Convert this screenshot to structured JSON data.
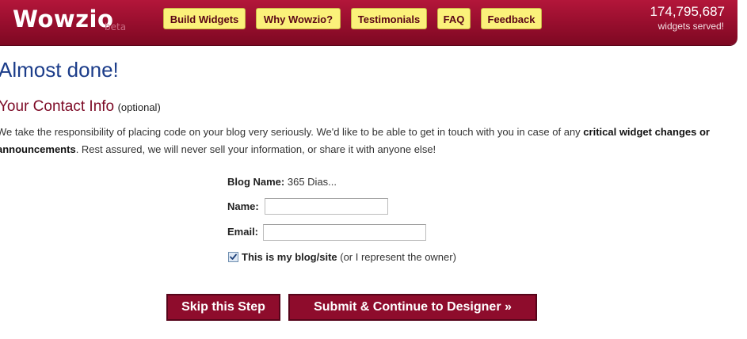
{
  "header": {
    "logo_text": "Wowzio",
    "logo_badge": "beta",
    "nav": [
      {
        "label": "Build Widgets"
      },
      {
        "label": "Why Wowzio?"
      },
      {
        "label": "Testimonials"
      },
      {
        "label": "FAQ"
      },
      {
        "label": "Feedback"
      }
    ],
    "widgets_served_count": "174,795,687",
    "widgets_served_label": "widgets served!",
    "colors": {
      "bar": "#9b0f2f",
      "nav_button": "#fbf17a",
      "nav_text": "#5a0616"
    }
  },
  "main": {
    "title": "Almost done!",
    "section_title": "Your Contact Info",
    "section_note": "(optional)",
    "intro": {
      "text_1": "We take the responsibility of placing code on your blog very seriously. We'd like to be able to get in touch with you in case of any ",
      "bold_1": "critical widget changes or announcements",
      "text_2": ". Rest assured, we will never sell your information, or share it with anyone else!"
    },
    "form": {
      "blog_name_label": "Blog Name:",
      "blog_name_value": "365 Dias...",
      "name_label": "Name:",
      "name_value": "",
      "email_label": "Email:",
      "email_value": "",
      "owner_checkbox_checked": true,
      "owner_label_bold": "This is my blog/site",
      "owner_label_rest": " (or I represent the owner)"
    },
    "buttons": {
      "skip_label": "Skip this Step",
      "submit_label": "Submit & Continue to Designer »"
    },
    "colors": {
      "title": "#1c3d8a",
      "section_title": "#7d0a26",
      "button": "#8e0c2c"
    }
  }
}
